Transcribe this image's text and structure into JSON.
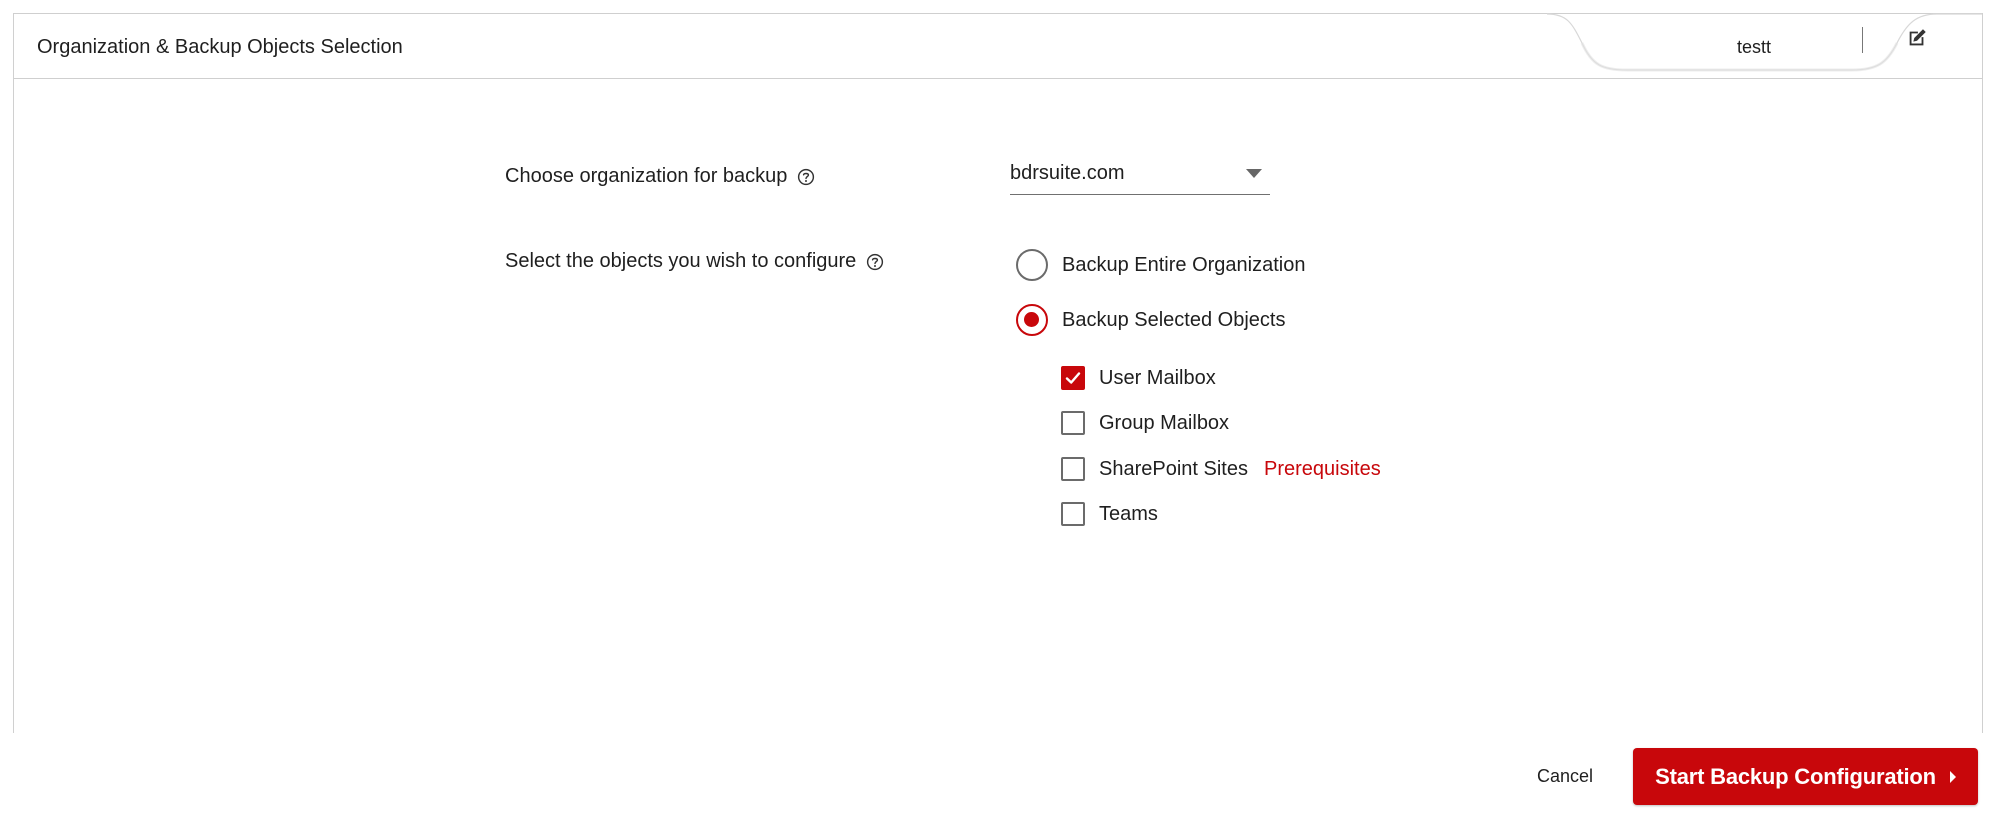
{
  "header": {
    "title": "Organization & Backup Objects Selection",
    "tab_name": "testt"
  },
  "form": {
    "org_label": "Choose organization for backup",
    "org_value": "bdrsuite.com",
    "objects_label": "Select the objects you wish to configure",
    "radios": [
      {
        "label": "Backup Entire Organization",
        "selected": false
      },
      {
        "label": "Backup Selected Objects",
        "selected": true
      }
    ],
    "objects": [
      {
        "label": "User Mailbox",
        "checked": true
      },
      {
        "label": "Group Mailbox",
        "checked": false
      },
      {
        "label": "SharePoint Sites",
        "checked": false
      },
      {
        "label": "Teams",
        "checked": false
      }
    ],
    "prerequisites_link": "Prerequisites"
  },
  "footer": {
    "cancel_label": "Cancel",
    "start_label": "Start Backup Configuration"
  },
  "colors": {
    "accent": "#c8070b",
    "border": "#cfcfcf"
  },
  "icons": {
    "help": "help-circle-icon",
    "edit": "edit-icon",
    "caret_down": "caret-down-icon",
    "caret_right": "caret-right-icon",
    "check": "check-icon"
  }
}
